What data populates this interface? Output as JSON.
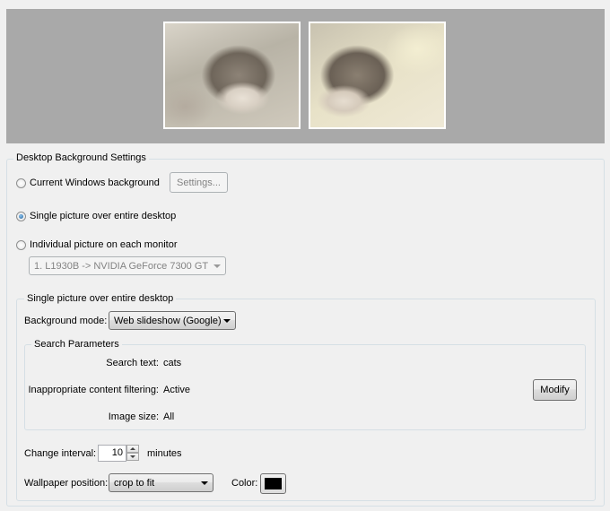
{
  "group_desktop": {
    "title": "Desktop Background Settings"
  },
  "options": {
    "current_windows": "Current Windows background",
    "single_picture": "Single picture over entire desktop",
    "individual_picture": "Individual picture on each monitor",
    "selected": "single_picture"
  },
  "settings_button": "Settings...",
  "monitor_select": {
    "value": "1. L1930B -> NVIDIA GeForce 7300 GT"
  },
  "group_single": {
    "title": "Single picture over entire desktop"
  },
  "background_mode": {
    "label": "Background mode:",
    "value": "Web slideshow (Google)"
  },
  "search_params": {
    "title": "Search Parameters",
    "search_text_label": "Search text:",
    "search_text_value": "cats",
    "filtering_label": "Inappropriate content filtering:",
    "filtering_value": "Active",
    "image_size_label": "Image size:",
    "image_size_value": "All",
    "modify_button": "Modify"
  },
  "change_interval": {
    "label": "Change interval:",
    "value": "10",
    "unit": "minutes"
  },
  "wallpaper_position": {
    "label": "Wallpaper position:",
    "value": "crop to fit"
  },
  "color": {
    "label": "Color:",
    "value": "#000000"
  },
  "colors": {
    "preview_bg": "#a9a9a9",
    "radio_selected": "#1e5f98"
  }
}
